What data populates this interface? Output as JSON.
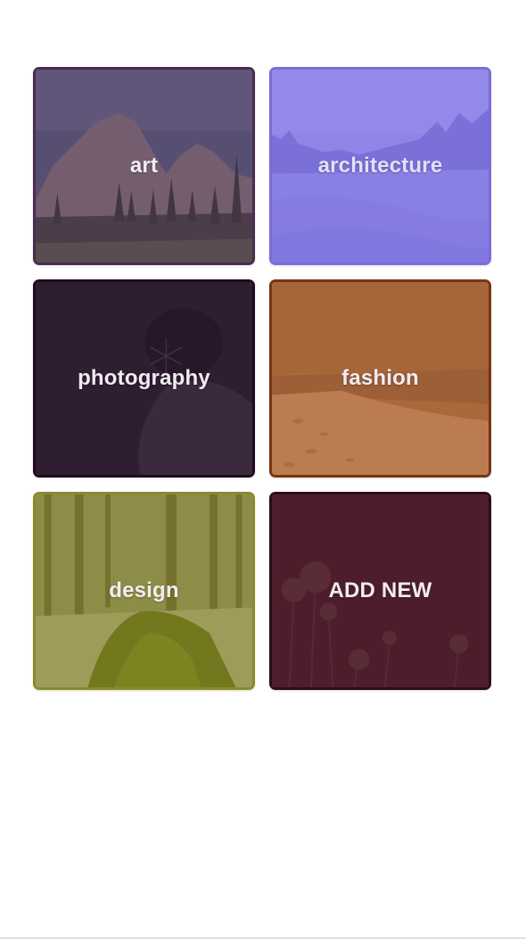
{
  "categories": [
    {
      "label": "art",
      "tint": "#563460",
      "border": "#4a2c4f",
      "image": "mountain-cliff-photo"
    },
    {
      "label": "architecture",
      "tint": "#786ce4",
      "border": "#7a6bd8",
      "image": "misty-lake-forest-photo"
    },
    {
      "label": "photography",
      "tint": "#2d1930",
      "border": "#1e0c1e",
      "image": "snowflake-on-dark-photo"
    },
    {
      "label": "fashion",
      "tint": "#a85c28",
      "border": "#7a3510",
      "image": "beach-shoreline-photo"
    },
    {
      "label": "design",
      "tint": "#82801e",
      "border": "#8b8a2a",
      "image": "mossy-log-forest-photo"
    }
  ],
  "add_new": {
    "label": "ADD NEW",
    "tint": "#461624",
    "border": "#2c0d18",
    "image": "wildflowers-photo"
  }
}
